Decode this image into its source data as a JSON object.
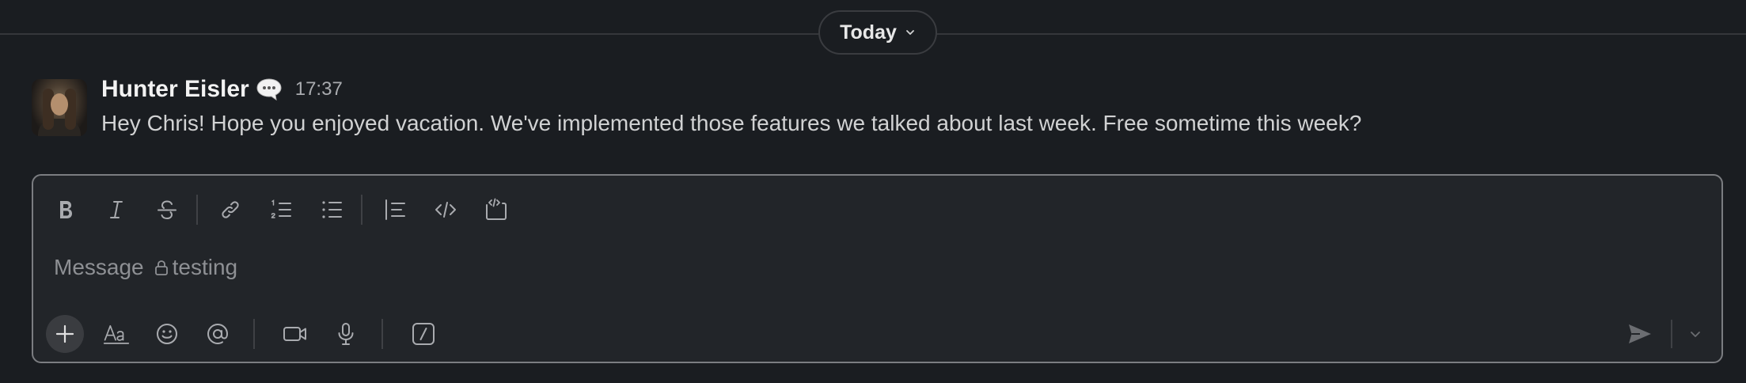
{
  "divider": {
    "label": "Today",
    "icon": "chevron-down-icon"
  },
  "message": {
    "author": "Hunter Eisler",
    "status_icon": "speech-balloon-icon",
    "timestamp": "17:37",
    "text": "Hey Chris! Hope you enjoyed vacation. We've implemented those features we talked about last week. Free sometime this week?"
  },
  "composer": {
    "placeholder_prefix": "Message",
    "channel_name": "testing",
    "channel_icon": "lock-icon",
    "formatting_tools": [
      "bold-icon",
      "italic-icon",
      "strikethrough-icon",
      "link-icon",
      "numbered-list-icon",
      "bulleted-list-icon",
      "blockquote-icon",
      "code-icon",
      "code-block-icon"
    ],
    "bottom_tools": [
      "plus-icon",
      "formatting-aa-icon",
      "emoji-icon",
      "mention-icon",
      "video-icon",
      "microphone-icon",
      "slash-command-icon"
    ],
    "send_icon": "send-icon",
    "send_options_icon": "chevron-down-icon"
  },
  "colors": {
    "background": "#1a1d21",
    "composer_bg": "#222529",
    "composer_border": "#7b7d81",
    "text_primary": "#d1d2d3",
    "text_muted": "#8e9094"
  }
}
